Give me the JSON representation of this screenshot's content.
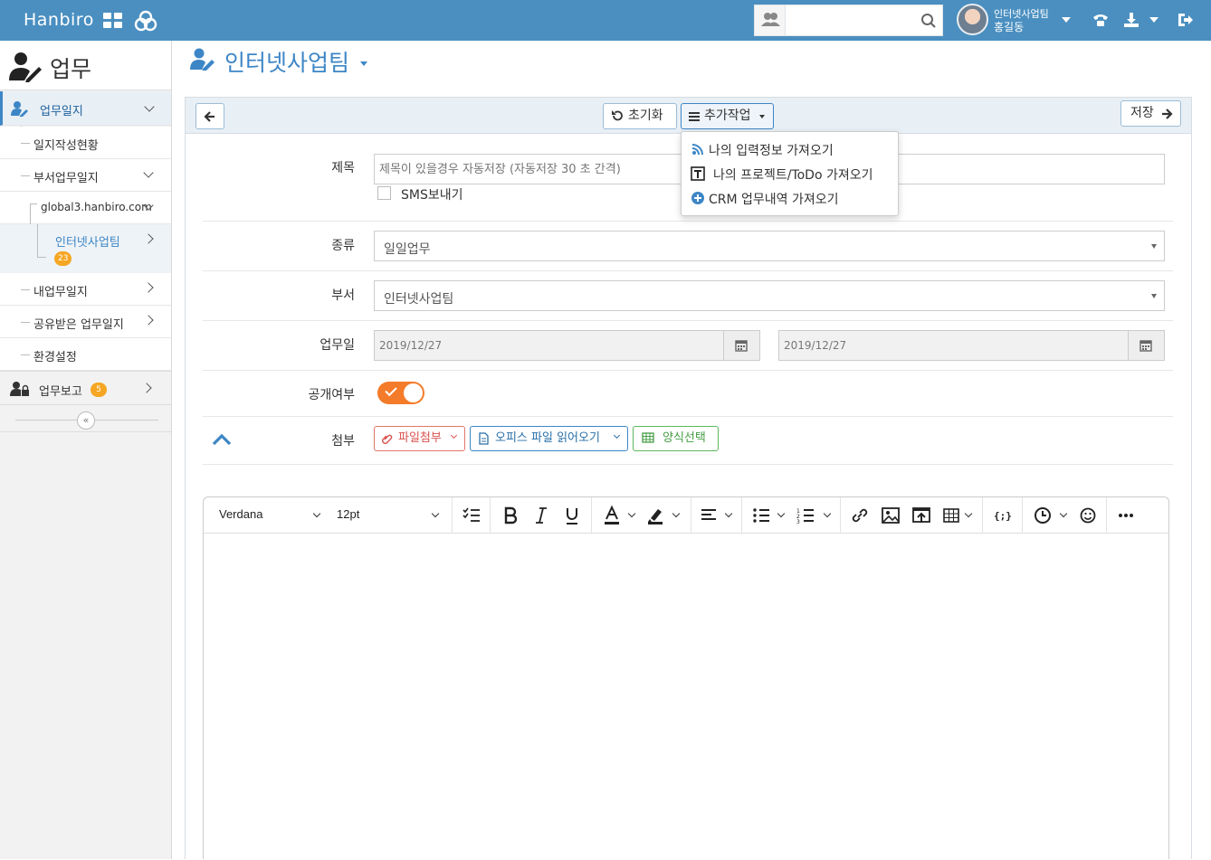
{
  "topbar": {
    "brand": "Hanbiro",
    "search_value": "",
    "user_dept": "인터넷사업팀",
    "user_name": "홍길동"
  },
  "sidebar": {
    "title": "업무",
    "items": [
      {
        "label": "업무일지"
      },
      {
        "label": "일지작성현황"
      },
      {
        "label": "부서업무일지"
      },
      {
        "label": "global3.hanbiro.com"
      },
      {
        "label": "인터넷사업팀",
        "badge": "23"
      },
      {
        "label": "내업무일지"
      },
      {
        "label": "공유받은 업무일지"
      },
      {
        "label": "환경설정"
      },
      {
        "label": "업무보고",
        "badge": "5"
      }
    ],
    "collapse_glyph": "«"
  },
  "main": {
    "title": "인터넷사업팀",
    "toolbar": {
      "reset_label": "초기화",
      "more_label": "추가작업",
      "save_label": "저장"
    },
    "menu": [
      {
        "label": "나의 입력정보 가져오기",
        "icon": "rss-icon"
      },
      {
        "label": "나의 프로젝트/ToDo 가져오기",
        "icon": "text-box-icon"
      },
      {
        "label": "CRM 업무내역 가져오기",
        "icon": "plus-circle-icon"
      }
    ],
    "form": {
      "title_label": "제목",
      "title_placeholder": "제목이 있을경우 자동저장 (자동저장 30 초 간격)",
      "sms_label": "SMS보내기",
      "type_label": "종류",
      "type_value": "일일업무",
      "dept_label": "부서",
      "dept_value": "인터넷사업팀",
      "date_label": "업무일",
      "date_start": "2019/12/27",
      "date_end": "2019/12/27",
      "public_label": "공개여부",
      "public_on": true,
      "attach_label": "첨부",
      "attach_file_label": "파일첨부",
      "office_label": "오피스 파일 읽어오기",
      "template_label": "양식선택"
    },
    "editor": {
      "font": "Verdana",
      "size": "12pt"
    }
  },
  "colors": {
    "topbar": "#4a8fc0",
    "accent": "#3d86c6",
    "toggle": "#f47b2a",
    "badge": "#f5a623",
    "file_btn": "#e0766a",
    "template_btn": "#5cb85c"
  }
}
